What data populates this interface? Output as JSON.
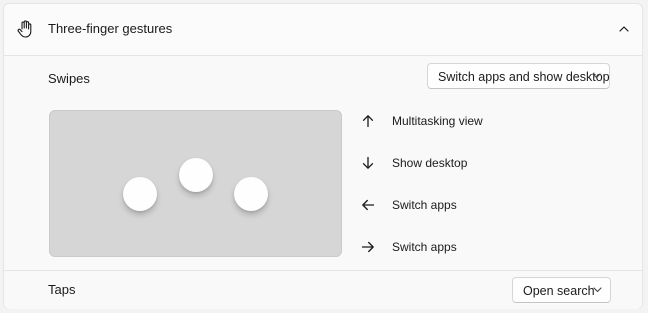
{
  "section": {
    "title": "Three-finger gestures",
    "icon": "hand-icon",
    "collapse_icon": "chevron-up-icon"
  },
  "swipes": {
    "label": "Swipes",
    "selected": "Switch apps and show desktop",
    "gestures": [
      {
        "direction": "up",
        "icon": "arrow-up-icon",
        "label": "Multitasking view"
      },
      {
        "direction": "down",
        "icon": "arrow-down-icon",
        "label": "Show desktop"
      },
      {
        "direction": "left",
        "icon": "arrow-left-icon",
        "label": "Switch apps"
      },
      {
        "direction": "right",
        "icon": "arrow-right-icon",
        "label": "Switch apps"
      }
    ]
  },
  "taps": {
    "label": "Taps",
    "selected": "Open search"
  },
  "colors": {
    "touchpad": "#d6d6d6",
    "finger": "#fefefe",
    "card": "#fbfbfb"
  }
}
